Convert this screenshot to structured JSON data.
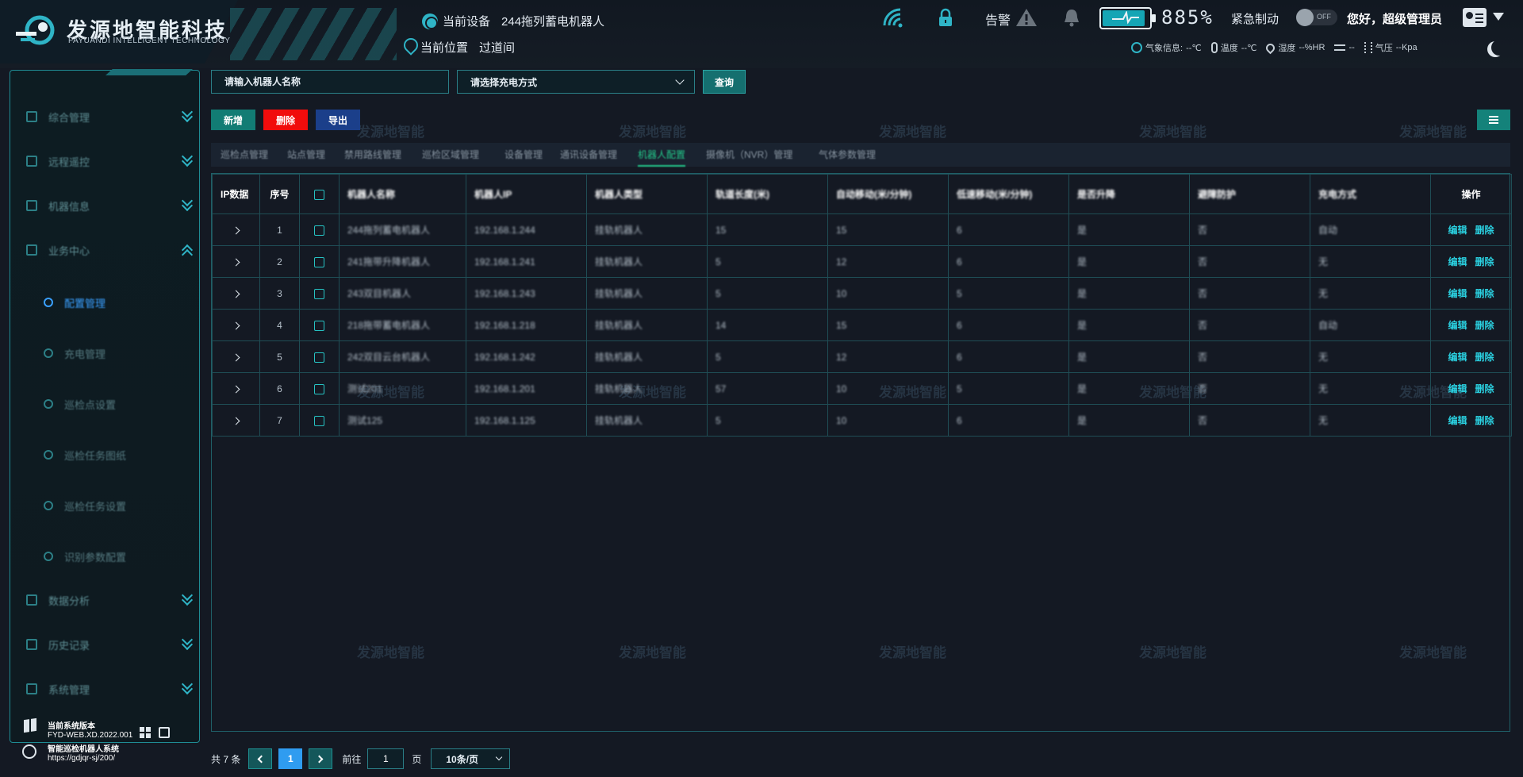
{
  "brand": {
    "title": "发源地智能科技",
    "subtitle": "FAYUANDI INTELLIGENT TECHNOLOGY"
  },
  "header": {
    "device_label": "当前设备",
    "device_value": "244拖列蓄电机器人",
    "location_label": "当前位置",
    "location_value": "过道间",
    "alarm_label": "告警",
    "battery_percent": "885%",
    "battery_level": 0.85,
    "emergency_label": "紧急制动",
    "toggle_text": "OFF",
    "greeting": "您好，超级管理员"
  },
  "weather": [
    {
      "icon": "weather-icon",
      "label": "气象信息:",
      "value": "--℃"
    },
    {
      "icon": "thermometer-icon",
      "label": "温度",
      "value": "--℃"
    },
    {
      "icon": "humidity-icon",
      "label": "湿度",
      "value": "--%HR"
    },
    {
      "icon": "wind-icon",
      "label": "",
      "value": "--"
    },
    {
      "icon": "pressure-icon",
      "label": "气压",
      "value": "--Kpa"
    }
  ],
  "sidebar": {
    "items": [
      {
        "label": "综合管理",
        "icon": "dashboard-icon",
        "expanded": false
      },
      {
        "label": "远程遥控",
        "icon": "monitor-icon",
        "expanded": false
      },
      {
        "label": "机器信息",
        "icon": "robot-info-icon",
        "expanded": false
      },
      {
        "label": "业务中心",
        "icon": "business-icon",
        "expanded": true
      },
      {
        "label": "数据分析",
        "icon": "analytics-icon",
        "expanded": false
      },
      {
        "label": "历史记录",
        "icon": "folder-icon",
        "expanded": false
      },
      {
        "label": "系统管理",
        "icon": "settings-icon",
        "expanded": false
      }
    ],
    "sub_items": [
      {
        "label": "配置管理",
        "active": true
      },
      {
        "label": "充电管理",
        "active": false
      },
      {
        "label": "巡检点设置",
        "active": false
      },
      {
        "label": "巡检任务图纸",
        "active": false
      },
      {
        "label": "巡检任务设置",
        "active": false
      },
      {
        "label": "识别参数配置",
        "active": false
      }
    ],
    "footer": {
      "version_title": "当前系统版本",
      "version_code": "FYD-WEB.XD.2022.001",
      "system_name": "智能巡检机器人系统",
      "url": "https://gdjqr-sj/200/"
    }
  },
  "filters": {
    "name_placeholder": "请输入机器人名称",
    "charge_placeholder": "请选择充电方式",
    "query_label": "查询"
  },
  "toolbar": {
    "add_label": "新增",
    "delete_label": "删除",
    "export_label": "导出"
  },
  "tabs": [
    {
      "label": "巡检点管理",
      "active": false
    },
    {
      "label": "站点管理",
      "active": false
    },
    {
      "label": "禁用路线管理",
      "active": false
    },
    {
      "label": "巡检区域管理",
      "active": false
    },
    {
      "label": "设备管理",
      "active": false
    },
    {
      "label": "通讯设备管理",
      "active": false
    },
    {
      "label": "机器人配置",
      "active": true
    },
    {
      "label": "摄像机（NVR）管理",
      "active": false
    },
    {
      "label": "气体参数管理",
      "active": false
    }
  ],
  "table": {
    "columns": [
      "IP数据",
      "序号",
      "",
      "机器人名称",
      "机器人IP",
      "机器人类型",
      "轨道长度(米)",
      "自动移动(米/分钟)",
      "低速移动(米/分钟)",
      "是否升降",
      "避障防护",
      "充电方式",
      "操作"
    ],
    "rows": [
      {
        "index": "1",
        "name": "244拖列蓄电机器人",
        "ip": "192.168.1.244",
        "type": "挂轨机器人",
        "length": "15",
        "auto_speed": "15",
        "low_speed": "6",
        "lift": "是",
        "avoid": "否",
        "charge": "自动"
      },
      {
        "index": "2",
        "name": "241拖带升降机器人",
        "ip": "192.168.1.241",
        "type": "挂轨机器人",
        "length": "5",
        "auto_speed": "12",
        "low_speed": "6",
        "lift": "是",
        "avoid": "否",
        "charge": "无"
      },
      {
        "index": "3",
        "name": "243双目机器人",
        "ip": "192.168.1.243",
        "type": "挂轨机器人",
        "length": "5",
        "auto_speed": "10",
        "low_speed": "5",
        "lift": "是",
        "avoid": "否",
        "charge": "无"
      },
      {
        "index": "4",
        "name": "218拖带蓄电机器人",
        "ip": "192.168.1.218",
        "type": "挂轨机器人",
        "length": "14",
        "auto_speed": "15",
        "low_speed": "6",
        "lift": "是",
        "avoid": "否",
        "charge": "自动"
      },
      {
        "index": "5",
        "name": "242双目云台机器人",
        "ip": "192.168.1.242",
        "type": "挂轨机器人",
        "length": "5",
        "auto_speed": "12",
        "low_speed": "6",
        "lift": "是",
        "avoid": "否",
        "charge": "无"
      },
      {
        "index": "6",
        "name": "测试201",
        "ip": "192.168.1.201",
        "type": "挂轨机器人",
        "length": "57",
        "auto_speed": "10",
        "low_speed": "5",
        "lift": "是",
        "avoid": "否",
        "charge": "无"
      },
      {
        "index": "7",
        "name": "测试125",
        "ip": "192.168.1.125",
        "type": "挂轨机器人",
        "length": "5",
        "auto_speed": "10",
        "low_speed": "6",
        "lift": "是",
        "avoid": "否",
        "charge": "无"
      }
    ],
    "edit_label": "编辑",
    "delete_label": "删除"
  },
  "pagination": {
    "total": "共 7 条",
    "current_page": "1",
    "goto_label": "前往",
    "goto_value": "1",
    "page_unit": "页",
    "page_size": "10条/页"
  },
  "watermark_text": "发源地智能",
  "colors": {
    "accent": "#2fb4c6",
    "active_tab": "#23c78a",
    "delete_button": "#f10c0c",
    "export_button": "#1b3f8a",
    "add_button": "#127c74",
    "active_page": "#2f9cf0"
  }
}
